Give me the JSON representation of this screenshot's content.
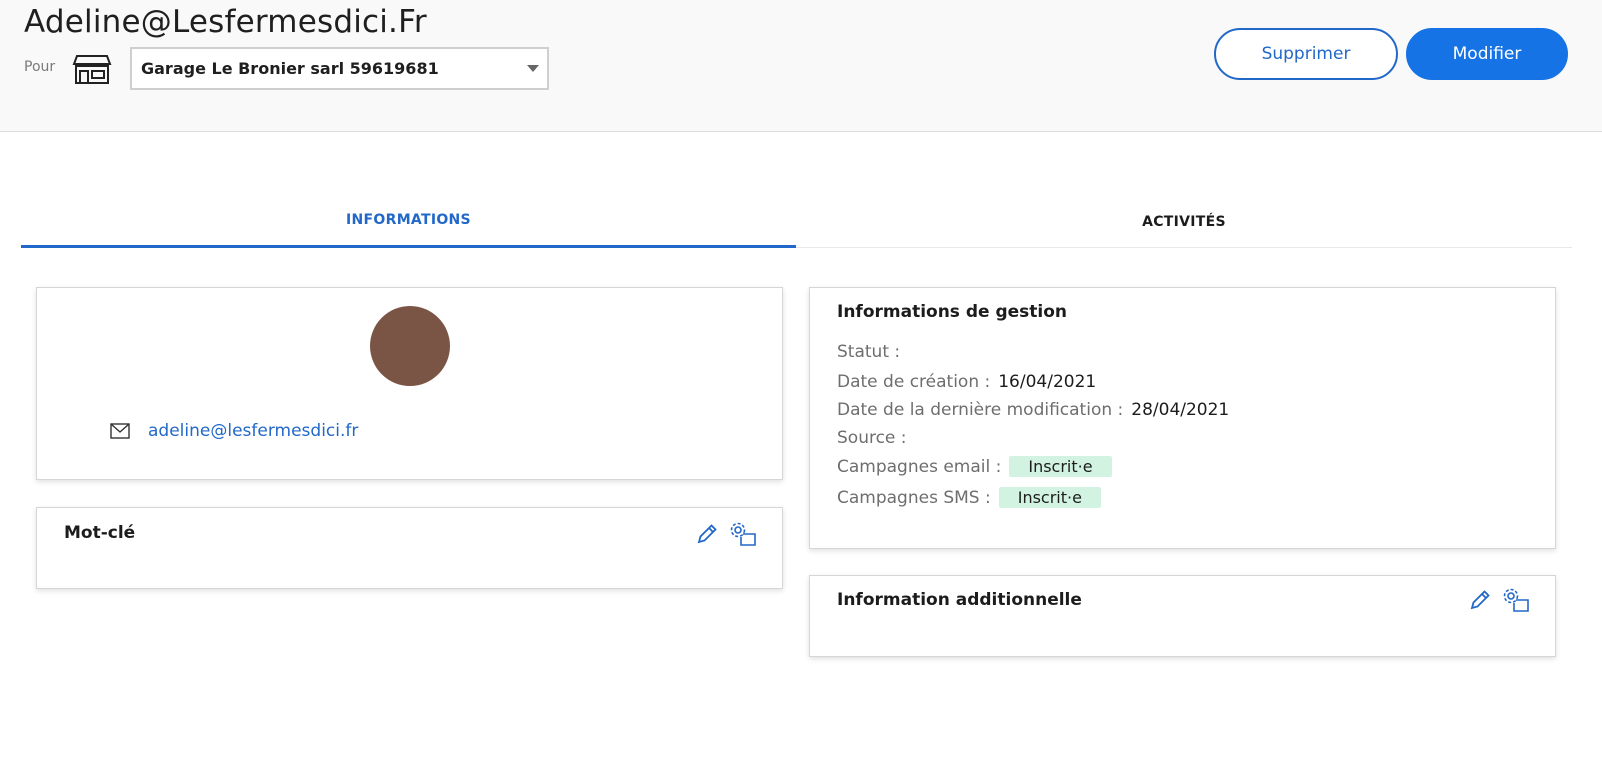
{
  "header": {
    "title": "Adeline@Lesfermesdici.Fr",
    "for_label": "Pour",
    "store_icon": "store-icon",
    "company_select": {
      "value": "Garage Le Bronier sarl 59619681"
    },
    "buttons": {
      "delete": "Supprimer",
      "edit": "Modifier"
    }
  },
  "tabs": [
    {
      "label": "INFORMATIONS",
      "active": true
    },
    {
      "label": "ACTIVITÉS",
      "active": false
    }
  ],
  "profile": {
    "avatar_color": "#7a5545",
    "email_icon": "mail-icon",
    "email": "adeline@lesfermesdici.fr"
  },
  "keyword": {
    "title": "Mot-clé"
  },
  "gestion": {
    "title": "Informations de gestion",
    "statut_label": "Statut :",
    "statut_value": "",
    "creation_label": "Date de création :",
    "creation_value": "16/04/2021",
    "modification_label": "Date de la dernière modification :",
    "modification_value": "28/04/2021",
    "source_label": "Source :",
    "source_value": "",
    "email_campaign_label": "Campagnes email :",
    "email_campaign_badge": "Inscrit·e",
    "sms_campaign_label": "Campagnes SMS :",
    "sms_campaign_badge": "Inscrit·e"
  },
  "additional": {
    "title": "Information additionnelle"
  },
  "colors": {
    "accent": "#2268c8",
    "primary_button": "#1673e6",
    "badge_bg": "#d3f3e2"
  }
}
